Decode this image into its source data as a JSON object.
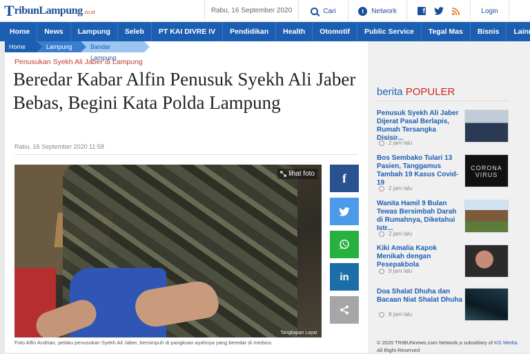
{
  "header": {
    "logo_main": "T",
    "logo_rest": "ribunLampung",
    "logo_suffix": ".co.id",
    "date": "Rabu, 16 September 2020",
    "search_label": "Cari",
    "network_label": "Network",
    "login_label": "Login"
  },
  "nav": [
    "Home",
    "News",
    "Lampung",
    "Seleb",
    "PT KAI DIVRE IV",
    "Pendidikan",
    "Health",
    "Otomotif",
    "Public Service",
    "Tegal Mas",
    "Bisnis",
    "Lainnya"
  ],
  "breadcrumb": [
    "Home",
    "Lampung",
    "Bandar Lampung"
  ],
  "article": {
    "kicker": "Penusukan Syekh Ali Jaber di Lampung",
    "title": "Beredar Kabar Alfin Penusuk Syekh Ali Jaber Bebas, Begini Kata Polda Lampung",
    "date": "Rabu, 16 September 2020 11:58",
    "photo_action": "lihat foto",
    "photo_credit": "Tangkapan Layar",
    "caption": "Foto Alfin Andrian, pelaku penusukan Syekh Ali Jaber, bersimpuh di pangkuan ayahnya yang beredar di medsos"
  },
  "share": {
    "facebook": "f",
    "linkedin": "in"
  },
  "sidebar": {
    "heading_a": "berita ",
    "heading_b": "POPULER",
    "items": [
      {
        "title": "Penusuk Syekh Ali Jaber Dijerat Pasal Berlapis, Rumah Tersangka Disisir...",
        "time": "2 jam lalu"
      },
      {
        "title": "Bos Sembako Tulari 13 Pasien, Tanggamus Tambah 19 Kasus Covid-19",
        "time": "2 jam lalu",
        "thumb_text": "CORONA VIRUS"
      },
      {
        "title": "Wanita Hamil 9 Bulan Tewas Bersimbah Darah di Rumahnya, Diketahui Istr...",
        "time": "2 jam lalu"
      },
      {
        "title": "Kiki Amalia Kapok Menikah dengan Pesepakbola",
        "time": "9 jam lalu"
      },
      {
        "title": "Doa Shalat Dhuha dan Bacaan Niat Shalat Dhuha",
        "time": "8 jam lalu"
      }
    ],
    "footer_a": "© 2020 TRIBUNnews.com Network,a subsidiary of ",
    "footer_kg": "KG Media",
    "footer_b": ". All Right Reserved"
  },
  "colors": {
    "brand_blue": "#1c5fb2",
    "accent_red": "#d0281c"
  }
}
